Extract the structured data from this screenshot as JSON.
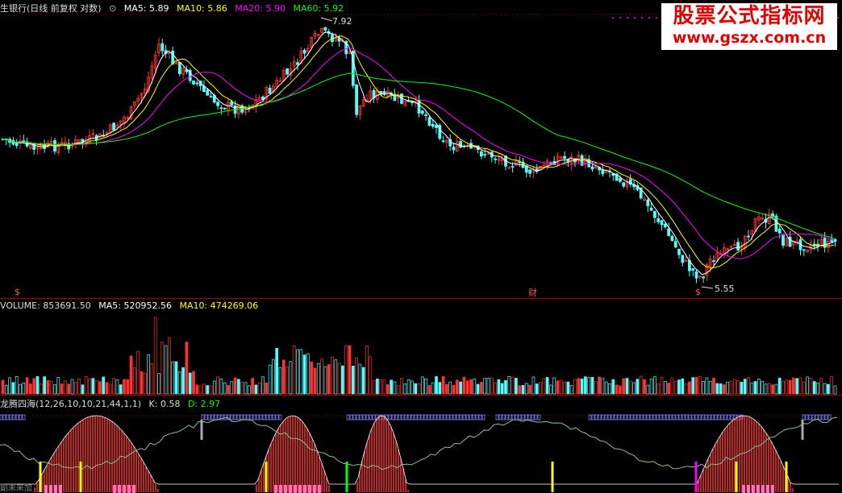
{
  "price_header": {
    "title": "生银行(日线 前复权 对数)",
    "ma5": "MA5: 5.89",
    "ma10": "MA10: 5.86",
    "ma20": "MA20: 5.90",
    "ma60": "MA60: 5.92"
  },
  "annotations": {
    "high": "7.92",
    "low": "5.55",
    "marker_cai": "财",
    "marker_s": "$"
  },
  "volume_header": {
    "volume": "VOLUME: 853691.50",
    "ma5": "MA5: 520952.56",
    "ma10": "MA10: 474269.06"
  },
  "indicator_header": {
    "name": "龙腾四海(12,26,10,10,21,44,1,1)",
    "k": "K: 0.58",
    "d": "D: 2.97"
  },
  "watermark": {
    "line1": "股票公式指标网",
    "line2": "www.gszx.com.cn"
  },
  "footer_text": "副未来加",
  "colors": {
    "up": "#ff3232",
    "down": "#54fcfc",
    "ma5": "#ffffff",
    "ma10": "#ffff00",
    "ma20": "#ff00ff",
    "ma60": "#00ff00",
    "grid": "#a00000"
  }
}
